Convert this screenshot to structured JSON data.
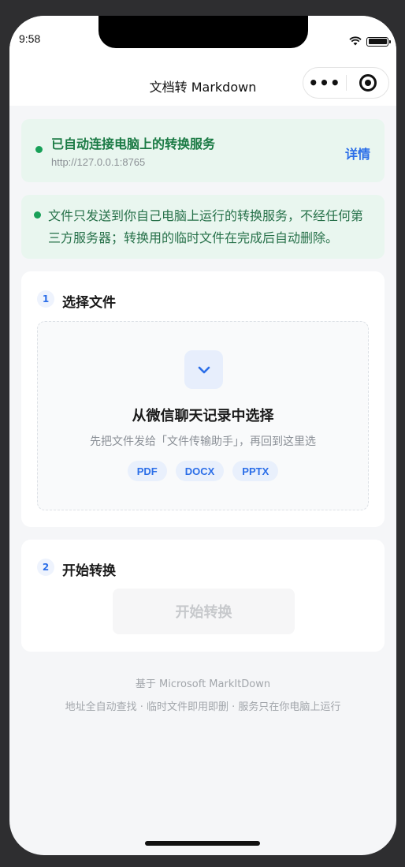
{
  "status": {
    "time": "9:58"
  },
  "nav": {
    "title": "文档转 Markdown",
    "more": "•••"
  },
  "connection": {
    "title": "已自动连接电脑上的转换服务",
    "address": "http://127.0.0.1:8765",
    "detail_label": "详情"
  },
  "privacy": {
    "text": "文件只发送到你自己电脑上运行的转换服务，不经任何第三方服务器；转换用的临时文件在完成后自动删除。"
  },
  "step1": {
    "number": "1",
    "title": "选择文件",
    "drop_title": "从微信聊天记录中选择",
    "drop_subtitle": "先把文件发给「文件传输助手」，再回到这里选",
    "formats": [
      "PDF",
      "DOCX",
      "PPTX"
    ]
  },
  "step2": {
    "number": "2",
    "title": "开始转换",
    "button_label": "开始转换"
  },
  "footer": {
    "line1": "基于 Microsoft MarkItDown",
    "line2": "地址全自动查找 · 临时文件即用即删 · 服务只在你电脑上运行"
  },
  "colors": {
    "accent": "#2b6ee8",
    "success": "#18a058",
    "success_bg": "#e9f6ef"
  }
}
